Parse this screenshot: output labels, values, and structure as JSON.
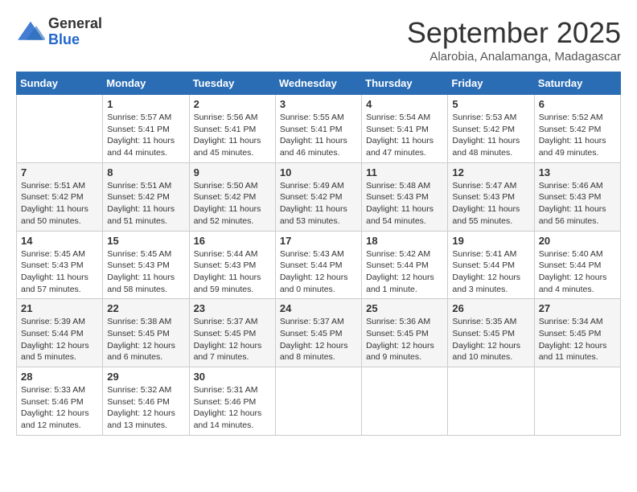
{
  "logo": {
    "general": "General",
    "blue": "Blue"
  },
  "title": "September 2025",
  "subtitle": "Alarobia, Analamanga, Madagascar",
  "headers": [
    "Sunday",
    "Monday",
    "Tuesday",
    "Wednesday",
    "Thursday",
    "Friday",
    "Saturday"
  ],
  "weeks": [
    [
      {
        "day": "",
        "info": ""
      },
      {
        "day": "1",
        "info": "Sunrise: 5:57 AM\nSunset: 5:41 PM\nDaylight: 11 hours\nand 44 minutes."
      },
      {
        "day": "2",
        "info": "Sunrise: 5:56 AM\nSunset: 5:41 PM\nDaylight: 11 hours\nand 45 minutes."
      },
      {
        "day": "3",
        "info": "Sunrise: 5:55 AM\nSunset: 5:41 PM\nDaylight: 11 hours\nand 46 minutes."
      },
      {
        "day": "4",
        "info": "Sunrise: 5:54 AM\nSunset: 5:41 PM\nDaylight: 11 hours\nand 47 minutes."
      },
      {
        "day": "5",
        "info": "Sunrise: 5:53 AM\nSunset: 5:42 PM\nDaylight: 11 hours\nand 48 minutes."
      },
      {
        "day": "6",
        "info": "Sunrise: 5:52 AM\nSunset: 5:42 PM\nDaylight: 11 hours\nand 49 minutes."
      }
    ],
    [
      {
        "day": "7",
        "info": "Sunrise: 5:51 AM\nSunset: 5:42 PM\nDaylight: 11 hours\nand 50 minutes."
      },
      {
        "day": "8",
        "info": "Sunrise: 5:51 AM\nSunset: 5:42 PM\nDaylight: 11 hours\nand 51 minutes."
      },
      {
        "day": "9",
        "info": "Sunrise: 5:50 AM\nSunset: 5:42 PM\nDaylight: 11 hours\nand 52 minutes."
      },
      {
        "day": "10",
        "info": "Sunrise: 5:49 AM\nSunset: 5:42 PM\nDaylight: 11 hours\nand 53 minutes."
      },
      {
        "day": "11",
        "info": "Sunrise: 5:48 AM\nSunset: 5:43 PM\nDaylight: 11 hours\nand 54 minutes."
      },
      {
        "day": "12",
        "info": "Sunrise: 5:47 AM\nSunset: 5:43 PM\nDaylight: 11 hours\nand 55 minutes."
      },
      {
        "day": "13",
        "info": "Sunrise: 5:46 AM\nSunset: 5:43 PM\nDaylight: 11 hours\nand 56 minutes."
      }
    ],
    [
      {
        "day": "14",
        "info": "Sunrise: 5:45 AM\nSunset: 5:43 PM\nDaylight: 11 hours\nand 57 minutes."
      },
      {
        "day": "15",
        "info": "Sunrise: 5:45 AM\nSunset: 5:43 PM\nDaylight: 11 hours\nand 58 minutes."
      },
      {
        "day": "16",
        "info": "Sunrise: 5:44 AM\nSunset: 5:43 PM\nDaylight: 11 hours\nand 59 minutes."
      },
      {
        "day": "17",
        "info": "Sunrise: 5:43 AM\nSunset: 5:44 PM\nDaylight: 12 hours\nand 0 minutes."
      },
      {
        "day": "18",
        "info": "Sunrise: 5:42 AM\nSunset: 5:44 PM\nDaylight: 12 hours\nand 1 minute."
      },
      {
        "day": "19",
        "info": "Sunrise: 5:41 AM\nSunset: 5:44 PM\nDaylight: 12 hours\nand 3 minutes."
      },
      {
        "day": "20",
        "info": "Sunrise: 5:40 AM\nSunset: 5:44 PM\nDaylight: 12 hours\nand 4 minutes."
      }
    ],
    [
      {
        "day": "21",
        "info": "Sunrise: 5:39 AM\nSunset: 5:44 PM\nDaylight: 12 hours\nand 5 minutes."
      },
      {
        "day": "22",
        "info": "Sunrise: 5:38 AM\nSunset: 5:45 PM\nDaylight: 12 hours\nand 6 minutes."
      },
      {
        "day": "23",
        "info": "Sunrise: 5:37 AM\nSunset: 5:45 PM\nDaylight: 12 hours\nand 7 minutes."
      },
      {
        "day": "24",
        "info": "Sunrise: 5:37 AM\nSunset: 5:45 PM\nDaylight: 12 hours\nand 8 minutes."
      },
      {
        "day": "25",
        "info": "Sunrise: 5:36 AM\nSunset: 5:45 PM\nDaylight: 12 hours\nand 9 minutes."
      },
      {
        "day": "26",
        "info": "Sunrise: 5:35 AM\nSunset: 5:45 PM\nDaylight: 12 hours\nand 10 minutes."
      },
      {
        "day": "27",
        "info": "Sunrise: 5:34 AM\nSunset: 5:45 PM\nDaylight: 12 hours\nand 11 minutes."
      }
    ],
    [
      {
        "day": "28",
        "info": "Sunrise: 5:33 AM\nSunset: 5:46 PM\nDaylight: 12 hours\nand 12 minutes."
      },
      {
        "day": "29",
        "info": "Sunrise: 5:32 AM\nSunset: 5:46 PM\nDaylight: 12 hours\nand 13 minutes."
      },
      {
        "day": "30",
        "info": "Sunrise: 5:31 AM\nSunset: 5:46 PM\nDaylight: 12 hours\nand 14 minutes."
      },
      {
        "day": "",
        "info": ""
      },
      {
        "day": "",
        "info": ""
      },
      {
        "day": "",
        "info": ""
      },
      {
        "day": "",
        "info": ""
      }
    ]
  ]
}
